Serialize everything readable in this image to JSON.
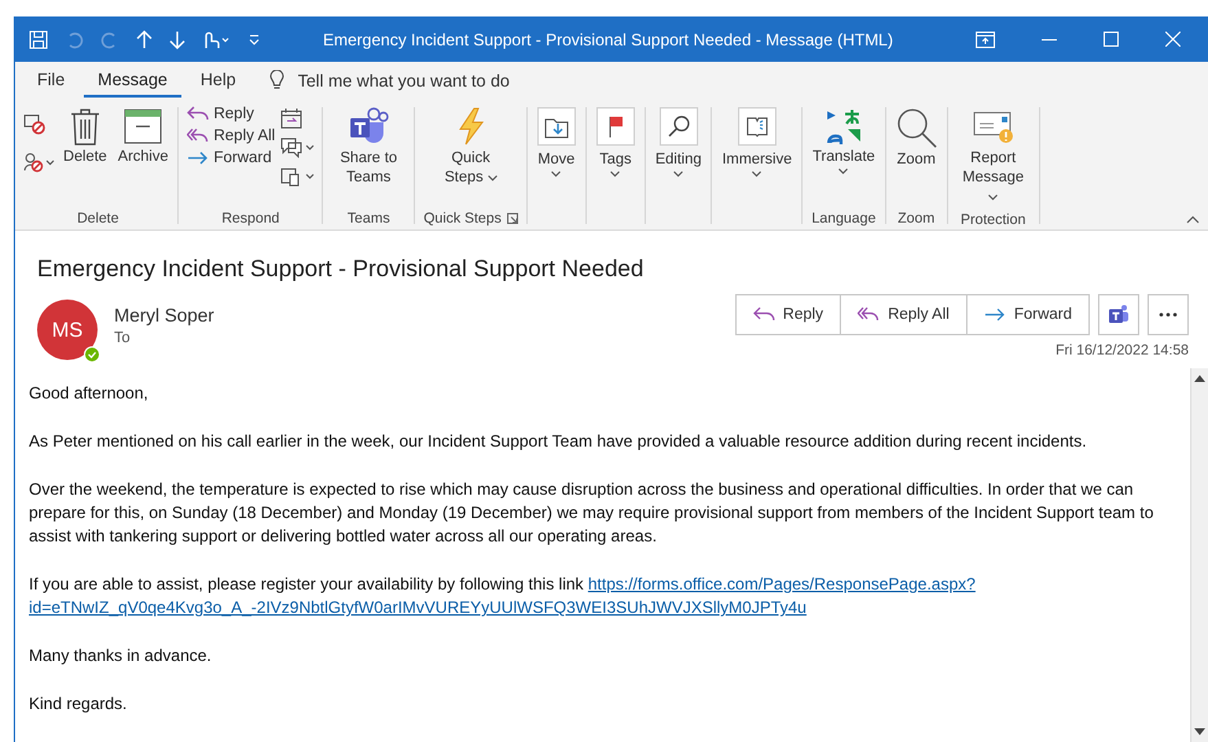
{
  "window": {
    "title": "Emergency Incident Support - Provisional Support Needed  -  Message (HTML)"
  },
  "menu_tabs": [
    {
      "label": "File",
      "selected": false
    },
    {
      "label": "Message",
      "selected": true
    },
    {
      "label": "Help",
      "selected": false
    }
  ],
  "search": {
    "placeholder": "Tell me what you want to do"
  },
  "ribbon_groups": [
    {
      "label": "Delete",
      "buttons": [
        {
          "label": "Delete"
        },
        {
          "label": "Archive"
        }
      ]
    },
    {
      "label": "Respond",
      "buttons": [
        {
          "label": "Reply"
        },
        {
          "label": "Reply All"
        },
        {
          "label": "Forward"
        }
      ]
    },
    {
      "label": "Teams",
      "buttons": [
        {
          "label": "Share to Teams"
        }
      ]
    },
    {
      "label": "Quick Steps",
      "buttons": [
        {
          "label": "Quick Steps"
        }
      ]
    },
    {
      "buttons": [
        {
          "label": "Move"
        }
      ]
    },
    {
      "buttons": [
        {
          "label": "Tags"
        }
      ]
    },
    {
      "buttons": [
        {
          "label": "Editing"
        }
      ]
    },
    {
      "buttons": [
        {
          "label": "Immersive"
        }
      ]
    },
    {
      "label": "Language",
      "buttons": [
        {
          "label": "Translate"
        }
      ]
    },
    {
      "label": "Zoom",
      "buttons": [
        {
          "label": "Zoom"
        }
      ]
    },
    {
      "label": "Protection",
      "buttons": [
        {
          "label": "Report Message"
        }
      ]
    }
  ],
  "message": {
    "subject": "Emergency Incident Support - Provisional Support Needed",
    "sender": {
      "initials": "MS",
      "name": "Meryl Soper",
      "to_label": "To",
      "online": true
    },
    "actions": [
      "Reply",
      "Reply All",
      "Forward"
    ],
    "date": "Fri 16/12/2022 14:58",
    "paragraphs": [
      {
        "text": "Good afternoon,"
      },
      {
        "text": "As Peter mentioned on his call earlier in the week, our Incident Support Team have provided a valuable resource addition during recent incidents."
      },
      {
        "text": "Over the weekend, the temperature is expected to rise which may cause disruption across the business and operational difficulties. In order that we can prepare for this, on Sunday (18 December) and Monday (19 December) we may require provisional support from members of the Incident Support team to assist with tankering support or delivering bottled water across all our operating areas."
      },
      {
        "text": "If you are able to assist, please register your availability by following this link",
        "link_lines": [
          "https://forms.office.com/Pages/ResponsePage.aspx?",
          "id=eTNwIZ_qV0qe4Kvg3o_A_-2IVz9NbtlGtyfW0arIMvVUREYyUUlWSFQ3WEI3SUhJWVJXSllyM0JPTy4u"
        ]
      },
      {
        "text": "Many thanks in advance."
      },
      {
        "text": "Kind regards."
      }
    ]
  }
}
